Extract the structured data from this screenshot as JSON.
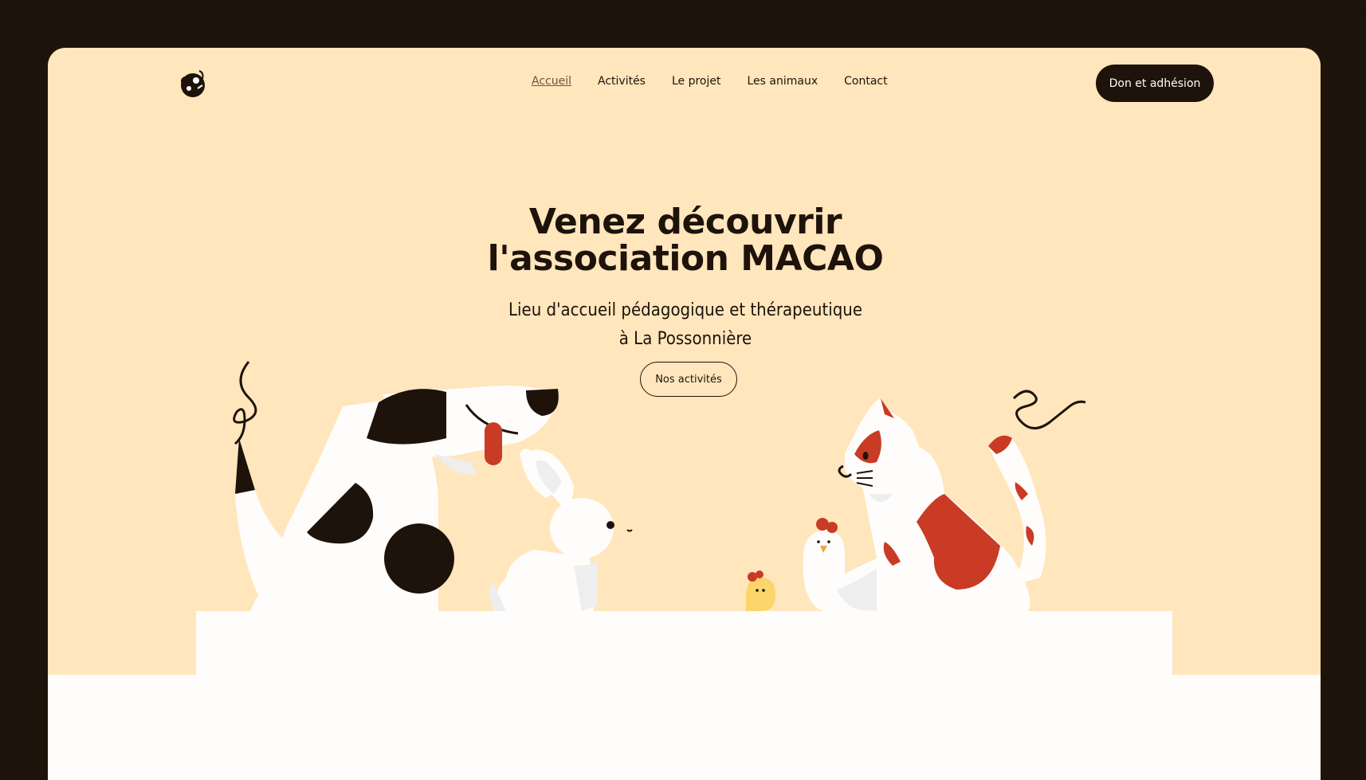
{
  "nav": {
    "logo": "macao-logo-icon",
    "links": [
      "Accueil",
      "Activités",
      "Le projet",
      "Les animaux",
      "Contact"
    ],
    "active": "Accueil",
    "cta": "Don et adhésion"
  },
  "hero": {
    "title_line1": "Venez découvrir",
    "title_line2": "l'association MACAO",
    "subtitle_line1": "Lieu d'accueil pédagogique et thérapeutique",
    "subtitle_line2": "à La Possonnière",
    "button": "Nos activités"
  },
  "illustration": {
    "animals": [
      "dog-illustration",
      "rabbit-illustration",
      "chick-illustration",
      "hen-illustration",
      "cat-illustration"
    ]
  },
  "colors": {
    "background": "#ffe6bd",
    "frame": "#1e130a",
    "accent_red": "#c93b24",
    "white": "#fffdfb",
    "chick_yellow": "#fbd46a"
  }
}
